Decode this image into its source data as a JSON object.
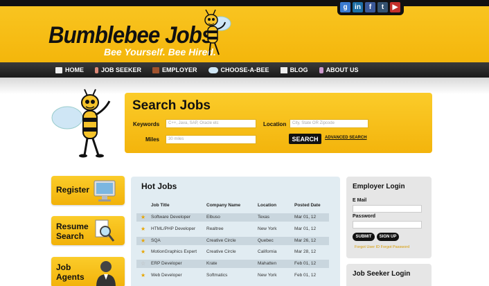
{
  "brand": {
    "title": "Bumblebee Jobs",
    "tagline": "Bee Yourself. Bee Hired."
  },
  "social": [
    {
      "name": "google-icon",
      "glyph": "g",
      "color": "#3b7bd1"
    },
    {
      "name": "linkedin-icon",
      "glyph": "in",
      "color": "#1d6fa5"
    },
    {
      "name": "facebook-icon",
      "glyph": "f",
      "color": "#3b5998"
    },
    {
      "name": "tumblr-icon",
      "glyph": "t",
      "color": "#34526f"
    },
    {
      "name": "youtube-icon",
      "glyph": "▶",
      "color": "#c4302b"
    }
  ],
  "nav": [
    "HOME",
    "JOB SEEKER",
    "EMPLOYER",
    "CHOOSE-A-BEE",
    "BLOG",
    "ABOUT US"
  ],
  "search": {
    "title": "Search Jobs",
    "keywords_label": "Keywords",
    "keywords_placeholder": "C++, Java, SAP, Oracle etc",
    "location_label": "Location",
    "location_placeholder": "City, State OR Zipcode",
    "miles_label": "Miles",
    "miles_placeholder": "30 miles",
    "button": "SEARCH",
    "advanced": "ADVANCED SEARCH"
  },
  "left_buttons": {
    "register": "Register",
    "resume": [
      "Resume",
      "Search"
    ],
    "agents": [
      "Job",
      "Agents"
    ]
  },
  "hot_jobs": {
    "title": "Hot Jobs",
    "headers": [
      "Job Title",
      "Company Name",
      "Location",
      "Posted Date"
    ],
    "rows": [
      {
        "title": "Software Developer",
        "company": "Elbuso",
        "location": "Texas",
        "date": "Mar 01, 12",
        "starred": true
      },
      {
        "title": "HTML/PHP Developer",
        "company": "Realtree",
        "location": "New York",
        "date": "Mar 01, 12",
        "starred": true
      },
      {
        "title": "SQA",
        "company": "Creative Circle",
        "location": "Quebec",
        "date": "Mar 26, 12",
        "starred": true
      },
      {
        "title": "MotionGraphics Expert",
        "company": "Creative Circle",
        "location": "California",
        "date": "Mar 28, 12",
        "starred": true
      },
      {
        "title": "ERP Developer",
        "company": "Krate",
        "location": "Mahatten",
        "date": "Feb 01, 12",
        "starred": false
      },
      {
        "title": "Web Developer",
        "company": "Softmatics",
        "location": "New York",
        "date": "Feb 01, 12",
        "starred": true
      }
    ]
  },
  "employer_login": {
    "title": "Employer Login",
    "email_label": "E Mail",
    "password_label": "Password",
    "submit": "SUBMIT",
    "signup": "SIGN UP",
    "forgot": "Forgot User ID Forgot Password"
  },
  "seeker_login": {
    "title": "Job Seeker Login"
  },
  "colors": {
    "accent": "#f4b60b",
    "dark": "#111111",
    "panel_blue": "#e1ecf2"
  }
}
